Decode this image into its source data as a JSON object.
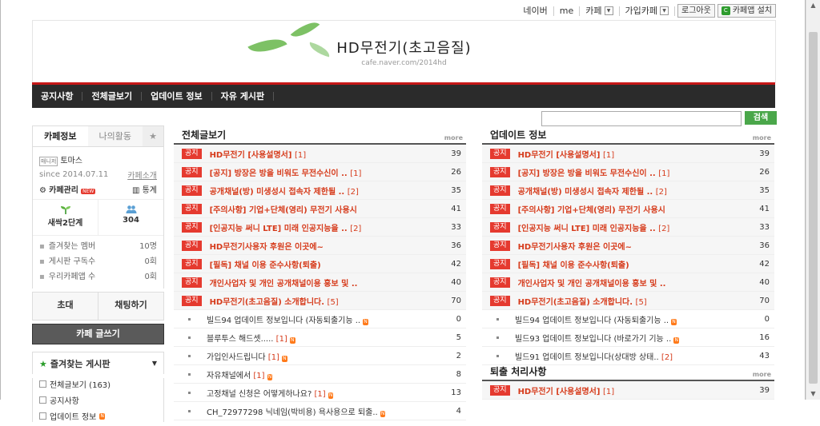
{
  "gnb": {
    "naver": "네이버",
    "me": "me",
    "cafe": "카페",
    "joined": "가입카페",
    "logout": "로그아웃",
    "install": "카페앱 설치"
  },
  "header": {
    "title": "HD무전기(초고음질)",
    "url": "cafe.naver.com/2014hd"
  },
  "menu": [
    "공지사항",
    "전체글보기",
    "업데이트 정보",
    "자유 게시판"
  ],
  "search": {
    "placeholder": "",
    "button": "검색"
  },
  "sidebar": {
    "tab_info": "카페정보",
    "tab_activity": "나의활동",
    "star": "★",
    "manager_badge": "매니저",
    "manager": "토마스",
    "since": "since 2014.07.11",
    "intro": "카페소개",
    "manage": "카페관리",
    "new": "NEW",
    "stats": "통계",
    "level": "새싹2단계",
    "members": "304",
    "mini": [
      {
        "label": "즐겨찾는 멤버",
        "value": "10명"
      },
      {
        "label": "게시판 구독수",
        "value": "0회"
      },
      {
        "label": "우리카페앱 수",
        "value": "0회"
      }
    ],
    "invite": "초대",
    "chat": "채팅하기",
    "write": "카페 글쓰기",
    "fav_title": "즐겨찾는 게시판",
    "fav_items": [
      "전체글보기 (163)",
      "공지사항",
      "업데이트 정보"
    ]
  },
  "panels": [
    {
      "title": "전체글보기",
      "more": "more",
      "rows": [
        {
          "notice": true,
          "title": "HD무전기 [사용설명서]",
          "ref": "[1]",
          "count": "39"
        },
        {
          "notice": true,
          "title": "[공지] 방장은 방을 비워도 무전수신이 ..",
          "ref": "[1]",
          "count": "26"
        },
        {
          "notice": true,
          "title": "공개채널(방) 미생성시 접속자 제한될 ..",
          "ref": "[2]",
          "count": "35"
        },
        {
          "notice": true,
          "title": "[주의사항] 기업+단체(영리) 무전기 사용시",
          "ref": "",
          "count": "41"
        },
        {
          "notice": true,
          "title": "[인공지능 써니 LTE] 미래 인공지능을 ..",
          "ref": "[2]",
          "count": "33"
        },
        {
          "notice": true,
          "title": "HD무전기사용자 후원은 이곳에~",
          "ref": "",
          "count": "36"
        },
        {
          "notice": true,
          "title": "[필독] 채널 이용 준수사항(퇴출)",
          "ref": "",
          "count": "42"
        },
        {
          "notice": true,
          "title": "개인사업자 및 개인 공개채널이용 홍보 및 ..",
          "ref": "",
          "count": "40"
        },
        {
          "notice": true,
          "title": "HD무전기(초고음질) 소개합니다.",
          "ref": "[5]",
          "count": "70"
        },
        {
          "notice": false,
          "title": "빌드94 업데이트 정보입니다 (자동퇴출기능 ..",
          "ref": "",
          "newmark": "N",
          "count": "0"
        },
        {
          "notice": false,
          "title": "블루투스 해드셋.....",
          "ref": "[1]",
          "newmark": "N",
          "count": "5"
        },
        {
          "notice": false,
          "title": "가입인사드립니다",
          "ref": "[1]",
          "newmark": "N",
          "count": "2"
        },
        {
          "notice": false,
          "title": "자유채널에서",
          "ref": "[1]",
          "newmark": "N",
          "count": "8"
        },
        {
          "notice": false,
          "title": "고정채널 신청은 어떻게하나요?",
          "ref": "[1]",
          "newmark": "N",
          "count": "13"
        },
        {
          "notice": false,
          "title": "CH_72977298 닉네임(박비용) 욕사용으로 퇴출..",
          "ref": "",
          "newmark": "N",
          "count": "4"
        }
      ]
    },
    {
      "title": "업데이트 정보",
      "more": "more",
      "rows": [
        {
          "notice": true,
          "title": "HD무전기 [사용설명서]",
          "ref": "[1]",
          "count": "39"
        },
        {
          "notice": true,
          "title": "[공지] 방장은 방을 비워도 무전수신이 ..",
          "ref": "[1]",
          "count": "26"
        },
        {
          "notice": true,
          "title": "공개채널(방) 미생성시 접속자 제한될 ..",
          "ref": "[2]",
          "count": "35"
        },
        {
          "notice": true,
          "title": "[주의사항] 기업+단체(영리) 무전기 사용시",
          "ref": "",
          "count": "41"
        },
        {
          "notice": true,
          "title": "[인공지능 써니 LTE] 미래 인공지능을 ..",
          "ref": "[2]",
          "count": "33"
        },
        {
          "notice": true,
          "title": "HD무전기사용자 후원은 이곳에~",
          "ref": "",
          "count": "36"
        },
        {
          "notice": true,
          "title": "[필독] 채널 이용 준수사항(퇴출)",
          "ref": "",
          "count": "42"
        },
        {
          "notice": true,
          "title": "개인사업자 및 개인 공개채널이용 홍보 및 ..",
          "ref": "",
          "count": "40"
        },
        {
          "notice": true,
          "title": "HD무전기(초고음질) 소개합니다.",
          "ref": "[5]",
          "count": "70"
        },
        {
          "notice": false,
          "title": "빌드94 업데이트 정보입니다 (자동퇴출기능 ..",
          "ref": "",
          "newmark": "N",
          "count": "0"
        },
        {
          "notice": false,
          "title": "빌드93 업데이트 정보입니다 (바로가기 기능 ..",
          "ref": "",
          "newmark": "N",
          "count": "16"
        },
        {
          "notice": false,
          "title": "빌드91 업데이트 정보입니다(상대방 상태..",
          "ref": "[2]",
          "count": "43"
        }
      ]
    },
    {
      "title": "퇴출 처리사항",
      "more": "more",
      "rows": [
        {
          "notice": true,
          "title": "HD무전기 [사용설명서]",
          "ref": "[1]",
          "count": "39"
        }
      ]
    }
  ],
  "notice_label": "공지"
}
